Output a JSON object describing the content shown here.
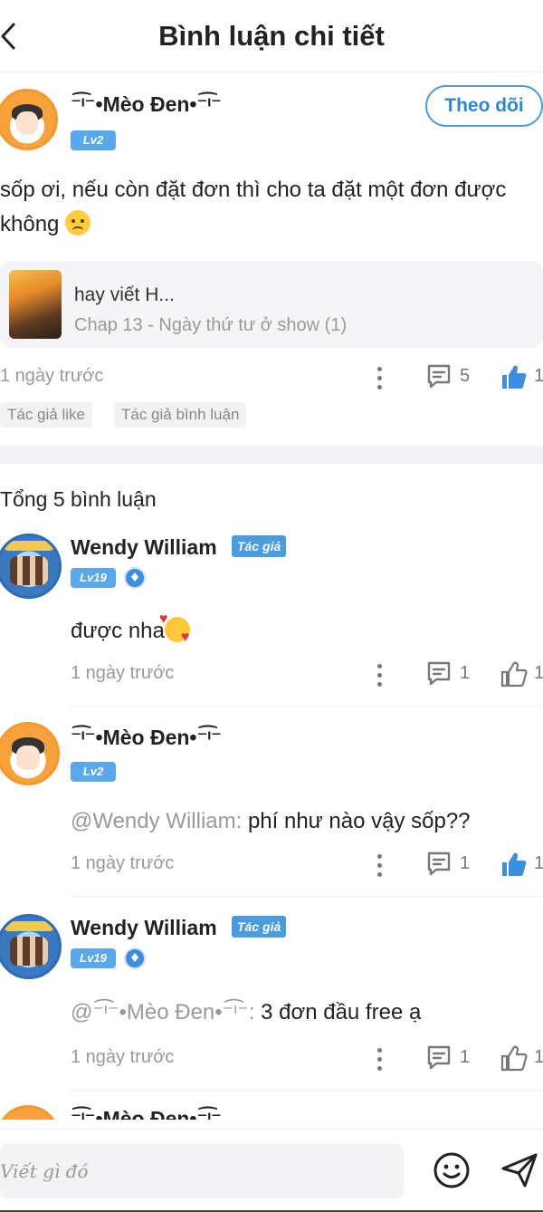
{
  "header": {
    "title": "Bình luận chi tiết"
  },
  "post": {
    "username": "⁻͡ᶦ⁻•Mèo Đen•⁻͡ᶦ⁻",
    "level": "Lv2",
    "follow_label": "Theo dõi",
    "text": "sốp ơi, nếu còn đặt đơn thì cho ta đặt một đơn được không",
    "chapter_title": "hay viết H...",
    "chapter_sub": "Chap 13 - Ngày thứ tư ở show (1)",
    "time": "1 ngày trước",
    "comment_count": "5",
    "like_count": "1",
    "tags": [
      "Tác giả like",
      "Tác giả bình luận"
    ]
  },
  "total_label": "Tổng 5 bình luận",
  "comments": [
    {
      "username": "Wendy William",
      "badge": "Tác giả",
      "level": "Lv19",
      "mention": "",
      "text": "được nha",
      "time": "1 ngày trước",
      "replies": "1",
      "likes": "1",
      "liked": false
    },
    {
      "username": "⁻͡ᶦ⁻•Mèo Đen•⁻͡ᶦ⁻",
      "badge": "",
      "level": "Lv2",
      "mention": "@Wendy William:",
      "text": " phí như nào vậy sốp??",
      "time": "1 ngày trước",
      "replies": "1",
      "likes": "1",
      "liked": true
    },
    {
      "username": "Wendy William",
      "badge": "Tác giả",
      "level": "Lv19",
      "mention": "@⁻͡ᶦ⁻•Mèo Đen•⁻͡ᶦ⁻:",
      "text": " 3 đơn đầu free ạ",
      "time": "1 ngày trước",
      "replies": "1",
      "likes": "1",
      "liked": false
    }
  ],
  "partial_username": "⁻͡ᶦ⁻•Mèo Đen•⁻͡ᶦ⁻",
  "input": {
    "placeholder": "Viết gì đó"
  },
  "colors": {
    "accent": "#4a9be0",
    "liked": "#3d8ee0",
    "muted": "#999999"
  }
}
